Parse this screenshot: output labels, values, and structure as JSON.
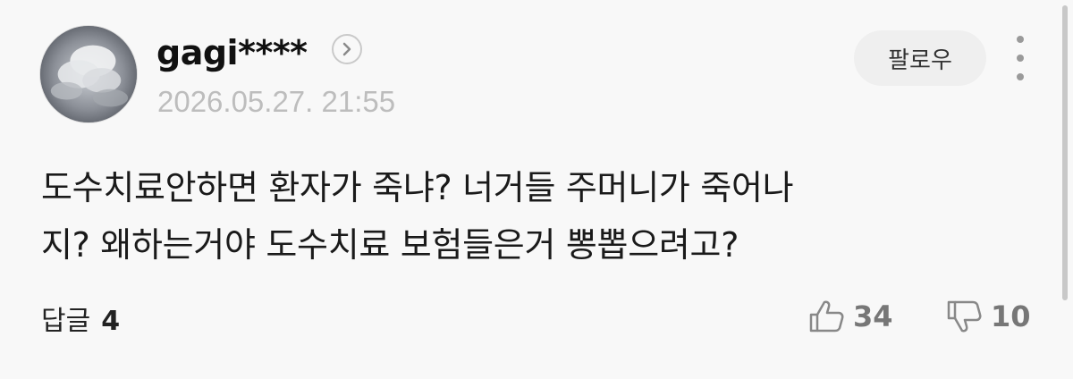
{
  "comment": {
    "username": "gagi****",
    "timestamp": "2026.05.27. 21:55",
    "follow_label": "팔로우",
    "body": "도수치료안하면 환자가 죽냐? 너거들 주머니가 죽어나\n지? 왜하는거야 도수치료 보험들은거 뽕뽑으려고?",
    "reply_label": "답글",
    "reply_count": "4",
    "like_count": "34",
    "dislike_count": "10"
  },
  "icons": {
    "profile_link": "chevron-right-icon",
    "more": "more-vertical-icon",
    "like": "thumbs-up-icon",
    "dislike": "thumbs-down-icon"
  },
  "colors": {
    "background": "#f8f8f8",
    "follow_button_bg": "#efefef",
    "timestamp": "#bdbdbd",
    "vote_count": "#777777"
  }
}
